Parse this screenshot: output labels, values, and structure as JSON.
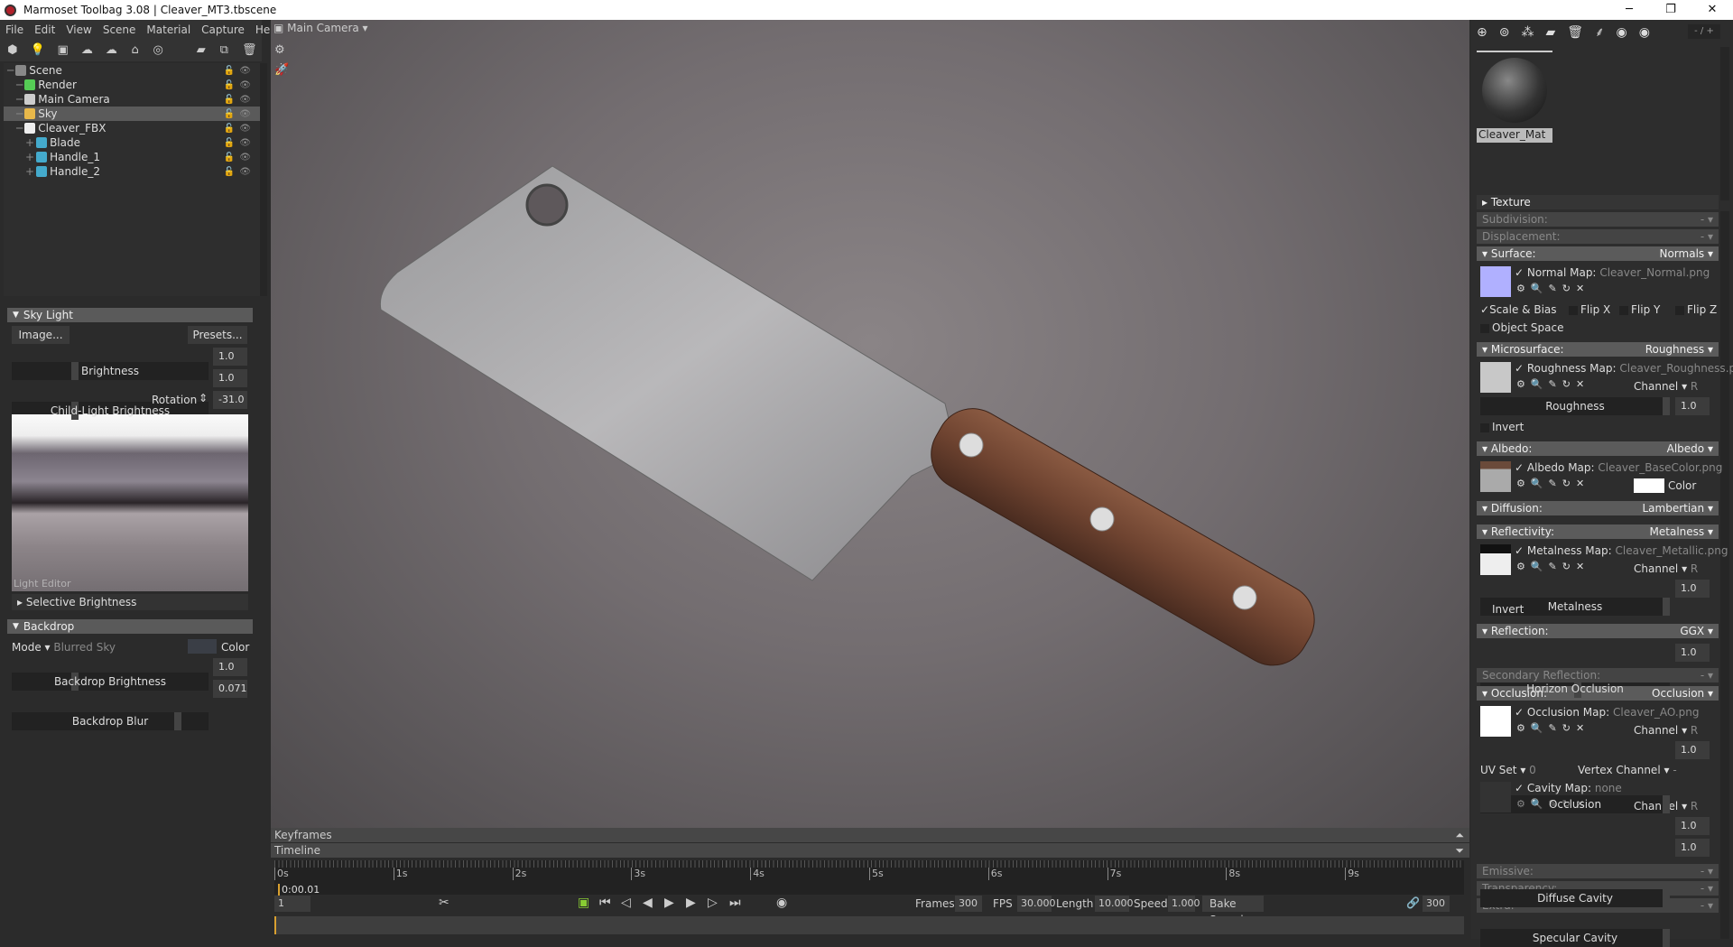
{
  "window": {
    "title": "Marmoset Toolbag 3.08  |  Cleaver_MT3.tbscene",
    "minimize": "─",
    "restore": "❐",
    "close": "✕"
  },
  "menu": [
    "File",
    "Edit",
    "View",
    "Scene",
    "Material",
    "Capture",
    "Help"
  ],
  "scene_tree": [
    {
      "label": "Scene",
      "indent": 0,
      "icon": "scene-icon"
    },
    {
      "label": "Render",
      "indent": 1,
      "icon": "render-gear-icon"
    },
    {
      "label": "Main Camera",
      "indent": 1,
      "icon": "camera-icon"
    },
    {
      "label": "Sky",
      "indent": 1,
      "icon": "sky-icon",
      "selected": true
    },
    {
      "label": "Cleaver_FBX",
      "indent": 1,
      "icon": "fbx-file-icon"
    },
    {
      "label": "Blade",
      "indent": 2,
      "icon": "mesh-icon"
    },
    {
      "label": "Handle_1",
      "indent": 2,
      "icon": "mesh-icon"
    },
    {
      "label": "Handle_2",
      "indent": 2,
      "icon": "mesh-icon"
    }
  ],
  "sky_light": {
    "title": "Sky Light",
    "image_btn": "Image...",
    "presets_btn": "Presets...",
    "brightness_label": "Brightness",
    "brightness": "1.0",
    "child_label": "Child-Light Brightness",
    "child": "1.0",
    "rotation_label": "Rotation",
    "rotation": "-31.0",
    "light_editor": "Light Editor",
    "selective": "Selective Brightness"
  },
  "backdrop": {
    "title": "Backdrop",
    "mode_label": "Mode",
    "mode": "Blurred Sky",
    "color_label": "Color",
    "brightness_label": "Backdrop Brightness",
    "brightness": "1.0",
    "blur_label": "Backdrop Blur",
    "blur": "0.071",
    "blur_fraction": 0.071
  },
  "viewport": {
    "camera": "Main Camera"
  },
  "material": {
    "name": "Cleaver_Mat",
    "counter": "- / +",
    "texture": "Texture",
    "subdivision": "Subdivision:",
    "subdivision_val": "-",
    "displacement": "Displacement:",
    "displacement_val": "-",
    "surface": "Surface:",
    "surface_val": "Normals",
    "normal_map": "Normal Map:",
    "normal_file": "Cleaver_Normal.png",
    "scale_bias": "Scale & Bias",
    "flipx": "Flip X",
    "flipy": "Flip Y",
    "flipz": "Flip Z",
    "object_space": "Object Space",
    "micro": "Microsurface:",
    "micro_val": "Roughness",
    "rough_map": "Roughness Map:",
    "rough_file": "Cleaver_Roughness.png",
    "channel": "Channel",
    "channel_val": "R",
    "roughness_label": "Roughness",
    "roughness": "1.0",
    "invert": "Invert",
    "albedo": "Albedo:",
    "albedo_val": "Albedo",
    "albedo_map": "Albedo Map:",
    "albedo_file": "Cleaver_BaseColor.png",
    "color_label": "Color",
    "diffusion": "Diffusion:",
    "diffusion_val": "Lambertian",
    "reflectivity": "Reflectivity:",
    "reflectivity_val": "Metalness",
    "metal_map": "Metalness Map:",
    "metal_file": "Cleaver_Metallic.png",
    "metalness_label": "Metalness",
    "metalness": "1.0",
    "reflection": "Reflection:",
    "reflection_val": "GGX",
    "horizon_label": "Horizon Occlusion",
    "horizon": "1.0",
    "secondary": "Secondary Reflection:",
    "secondary_val": "-",
    "occlusion": "Occlusion:",
    "occlusion_val": "Occlusion",
    "ao_map": "Occlusion Map:",
    "ao_file": "Cleaver_AO.png",
    "occlusion_label": "Occlusion",
    "occlusion_num": "1.0",
    "uvset": "UV Set",
    "uvset_val": "0",
    "vertex_channel": "Vertex Channel",
    "vertex_channel_val": "-",
    "cavity_map": "Cavity Map:",
    "cavity_file": "none",
    "diffuse_cavity": "Diffuse Cavity",
    "diffuse_cavity_val": "1.0",
    "specular_cavity": "Specular Cavity",
    "specular_cavity_val": "1.0",
    "emissive": "Emissive:",
    "transparency": "Transparency:",
    "extra": "Extra:",
    "dash": "-"
  },
  "timeline": {
    "keyframes": "Keyframes",
    "timeline": "Timeline",
    "ticks": [
      "0s",
      "1s",
      "2s",
      "3s",
      "4s",
      "5s",
      "6s",
      "7s",
      "8s",
      "9s"
    ],
    "current_time": "0:00.01",
    "frame": "1",
    "frames_label": "Frames",
    "frames": "300",
    "fps_label": "FPS",
    "fps": "30.000",
    "length_label": "Length",
    "length": "10.000",
    "speed_label": "Speed",
    "speed": "1.000",
    "bake_speed": "Bake Speed",
    "end_frame": "300"
  }
}
